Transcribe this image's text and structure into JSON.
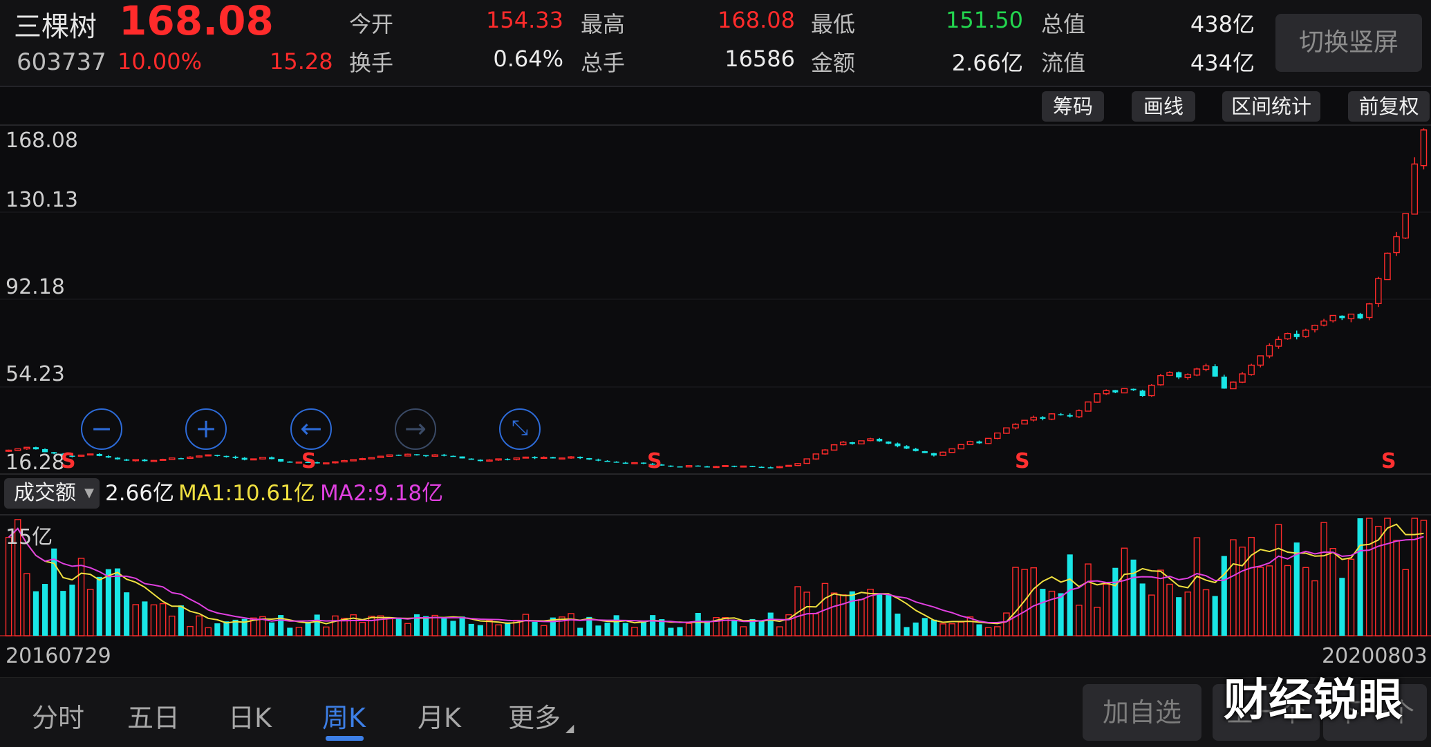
{
  "stock": {
    "name": "三棵树",
    "code": "603737",
    "price": "168.08",
    "change_pct": "10.00%",
    "change": "15.28"
  },
  "quote": {
    "open_label": "今开",
    "open": "154.33",
    "high_label": "最高",
    "high": "168.08",
    "low_label": "最低",
    "low": "151.50",
    "total_value_label": "总值",
    "total_value": "438亿",
    "turnover_label": "换手",
    "turnover": "0.64%",
    "volume_label": "总手",
    "volume": "16586",
    "amount_label": "金额",
    "amount": "2.66亿",
    "float_value_label": "流值",
    "float_value": "434亿"
  },
  "header_button": "切换竖屏",
  "tools": [
    "筹码",
    "画线",
    "区间统计",
    "前复权"
  ],
  "price_axis": [
    "168.08",
    "130.13",
    "92.18",
    "54.23",
    "16.28"
  ],
  "signal_marker": "S",
  "volume_panel": {
    "selector": "成交额",
    "value": "2.66亿",
    "ma1": "MA1:10.61亿",
    "ma2": "MA2:9.18亿",
    "axis_max": "15亿"
  },
  "dates": {
    "start": "20160729",
    "end": "20200803"
  },
  "tabs": [
    "分时",
    "五日",
    "日K",
    "周K",
    "月K",
    "更多"
  ],
  "active_tab": "周K",
  "bottom_buttons": [
    "加自选",
    "上一个",
    "下一个"
  ],
  "watermark": "财经锐眼",
  "colors": {
    "up": "#ff2b2b",
    "down": "#19e6e6",
    "ma1": "#f0e040",
    "ma2": "#e040e0",
    "accent": "#3d7fe6"
  },
  "chart_data": {
    "type": "candlestick",
    "interval": "weekly",
    "x_range": [
      "20160729",
      "20200803"
    ],
    "y_axis_ticks": [
      16.28,
      54.23,
      92.18,
      130.13,
      168.08
    ],
    "ylim": [
      16.28,
      168.08
    ],
    "closes": [
      24.5,
      25.1,
      25.8,
      24.9,
      23.6,
      23.0,
      22.1,
      21.7,
      22.3,
      22.8,
      21.9,
      21.2,
      20.4,
      19.8,
      20.3,
      19.6,
      19.9,
      20.4,
      21.0,
      20.8,
      21.4,
      21.9,
      22.4,
      22.0,
      21.5,
      21.0,
      20.2,
      20.6,
      21.3,
      20.5,
      19.4,
      18.9,
      19.2,
      19.0,
      18.6,
      18.8,
      19.3,
      19.8,
      20.3,
      20.7,
      21.2,
      21.8,
      22.4,
      22.0,
      22.7,
      22.3,
      21.8,
      22.4,
      22.0,
      21.6,
      20.8,
      20.2,
      19.6,
      20.1,
      20.6,
      20.3,
      21.0,
      21.4,
      20.9,
      21.3,
      20.8,
      21.0,
      21.5,
      20.9,
      20.3,
      19.8,
      19.4,
      19.0,
      18.6,
      18.9,
      18.5,
      18.1,
      17.6,
      17.2,
      17.0,
      17.6,
      17.3,
      16.9,
      17.2,
      17.6,
      17.1,
      17.4,
      17.0,
      16.8,
      16.7,
      17.2,
      17.7,
      18.5,
      20.6,
      22.8,
      24.6,
      26.9,
      28.1,
      27.3,
      28.7,
      29.6,
      28.5,
      27.4,
      26.3,
      25.2,
      24.1,
      23.2,
      22.1,
      23.6,
      25.1,
      27.0,
      28.4,
      27.6,
      29.8,
      32.2,
      34.5,
      36.1,
      37.9,
      39.2,
      38.6,
      40.8,
      40.3,
      39.6,
      42.2,
      46.1,
      49.8,
      51.2,
      50.4,
      52.1,
      51.4,
      48.8,
      53.6,
      57.9,
      59.3,
      57.1,
      58.4,
      60.9,
      62.3,
      57.5,
      52.1,
      55.0,
      58.7,
      62.6,
      66.8,
      71.4,
      74.1,
      76.8,
      75.2,
      78.3,
      80.5,
      82.4,
      84.9,
      83.7,
      85.5,
      83.6,
      90.1,
      101.4,
      112.8,
      120.2,
      130.6,
      152.8,
      168.08
    ]
  }
}
